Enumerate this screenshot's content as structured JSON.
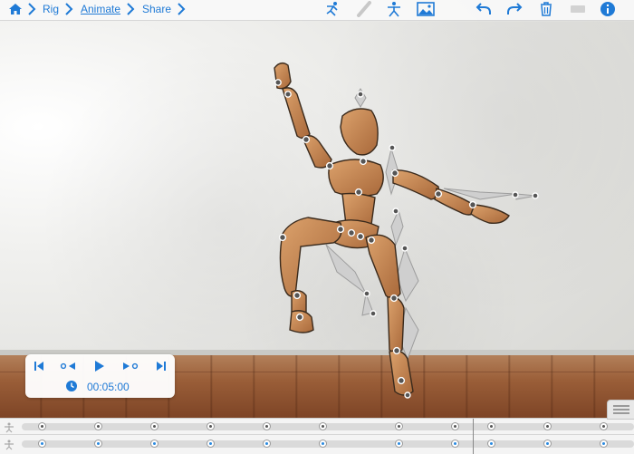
{
  "breadcrumb": {
    "rig": "Rig",
    "animate": "Animate",
    "share": "Share"
  },
  "toolbar_icons": {
    "home": "home-icon",
    "pose_select": "pose-select-icon",
    "bone": "bone-icon",
    "figure": "figure-icon",
    "background": "image-icon",
    "undo": "undo-icon",
    "redo": "redo-icon",
    "delete": "trash-icon",
    "info": "info-icon"
  },
  "playback": {
    "time": "00:05:00",
    "buttons": [
      "skip-to-start",
      "previous-keyframe",
      "play",
      "next-keyframe",
      "skip-to-end"
    ]
  },
  "colors": {
    "accent": "#1f7ad6",
    "mannequin": "#c98a54",
    "mannequin_outline": "#3a2a1c"
  },
  "timeline": {
    "track1_keys": [
      46,
      108,
      170,
      232,
      294,
      356,
      440,
      502,
      542,
      604,
      666
    ],
    "track2_keys": [
      46,
      108,
      170,
      232,
      294,
      356,
      440,
      502,
      542,
      604,
      666
    ]
  }
}
